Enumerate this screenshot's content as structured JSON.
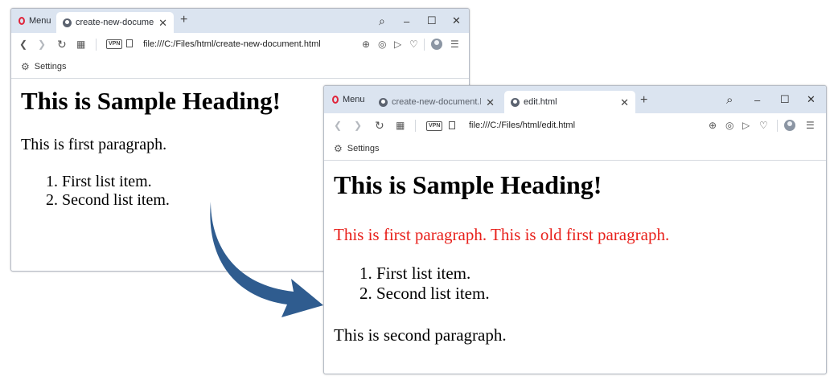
{
  "colors": {
    "tabbar_bg": "#dbe4f0",
    "opera_red": "#e0243a",
    "paragraph_red": "#e8211c",
    "arrow_blue": "#2f5c8f"
  },
  "window1": {
    "menu_label": "Menu",
    "tab_active_label": "create-new-document.html",
    "tab_close": "✕",
    "new_tab": "+",
    "controls": {
      "search": "⌕",
      "minimize": "–",
      "maximize": "☐",
      "close": "✕"
    },
    "toolbar": {
      "back": "❮",
      "forward": "❯",
      "reload": "↻",
      "speed_dial": "▦",
      "vpn": "VPN",
      "url": "file:///C:/Files/html/create-new-document.html"
    },
    "toolbar_right": {
      "zoom": "⊕",
      "camera": "◎",
      "send": "▷",
      "heart": "♡",
      "menu": "☰"
    },
    "bookmarks": {
      "settings": "Settings",
      "gear": "⚙"
    },
    "page": {
      "heading": "This is Sample Heading!",
      "paragraph1": "This is first paragraph.",
      "list": [
        "1. First list item.",
        "2. Second list item."
      ]
    }
  },
  "window2": {
    "menu_label": "Menu",
    "tab_inactive_label": "create-new-document.html",
    "tab_active_label": "edit.html",
    "tab_close": "✕",
    "new_tab": "+",
    "controls": {
      "search": "⌕",
      "minimize": "–",
      "maximize": "☐",
      "close": "✕"
    },
    "toolbar": {
      "back": "❮",
      "forward": "❯",
      "reload": "↻",
      "speed_dial": "▦",
      "vpn": "VPN",
      "url": "file:///C:/Files/html/edit.html"
    },
    "toolbar_right": {
      "zoom": "⊕",
      "camera": "◎",
      "send": "▷",
      "heart": "♡",
      "menu": "☰"
    },
    "bookmarks": {
      "settings": "Settings",
      "gear": "⚙"
    },
    "page": {
      "heading": "This is Sample Heading!",
      "paragraph1": "This is first paragraph. This is old first paragraph.",
      "list": [
        "1. First list item.",
        "2. Second list item."
      ],
      "paragraph2": "This is second paragraph."
    }
  }
}
